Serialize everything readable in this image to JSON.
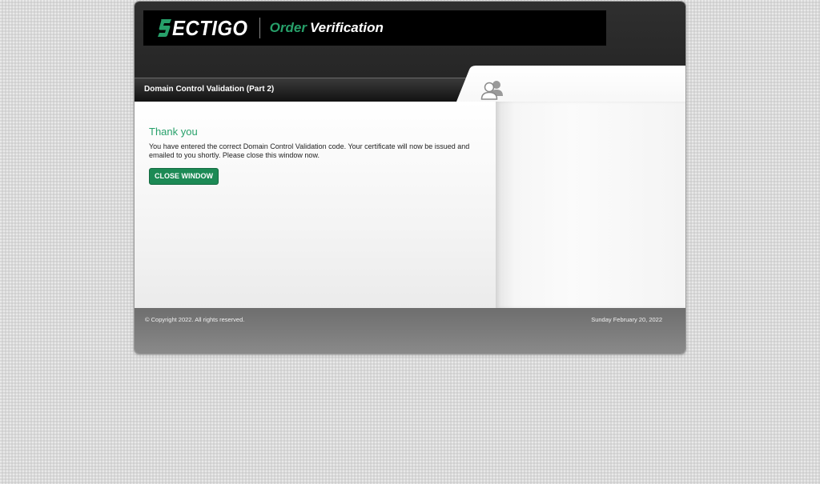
{
  "brand": {
    "logo_text": "ECTIGO",
    "logo_icon": "sectigo-s-logo-icon",
    "title_part1": "Order",
    "title_part2": "Verification",
    "accent_color": "#27a06a"
  },
  "section": {
    "title": "Domain Control Validation (Part 2)",
    "side_icon": "users-icon"
  },
  "main": {
    "heading": "Thank you",
    "message": "You have entered the correct Domain Control Validation code. Your certificate will now be issued and emailed to you shortly. Please close this window now.",
    "close_button_label": "CLOSE WINDOW",
    "button_color": "#1c8a55"
  },
  "footer": {
    "copyright": "© Copyright 2022. All rights reserved.",
    "date": "Sunday February 20, 2022"
  }
}
